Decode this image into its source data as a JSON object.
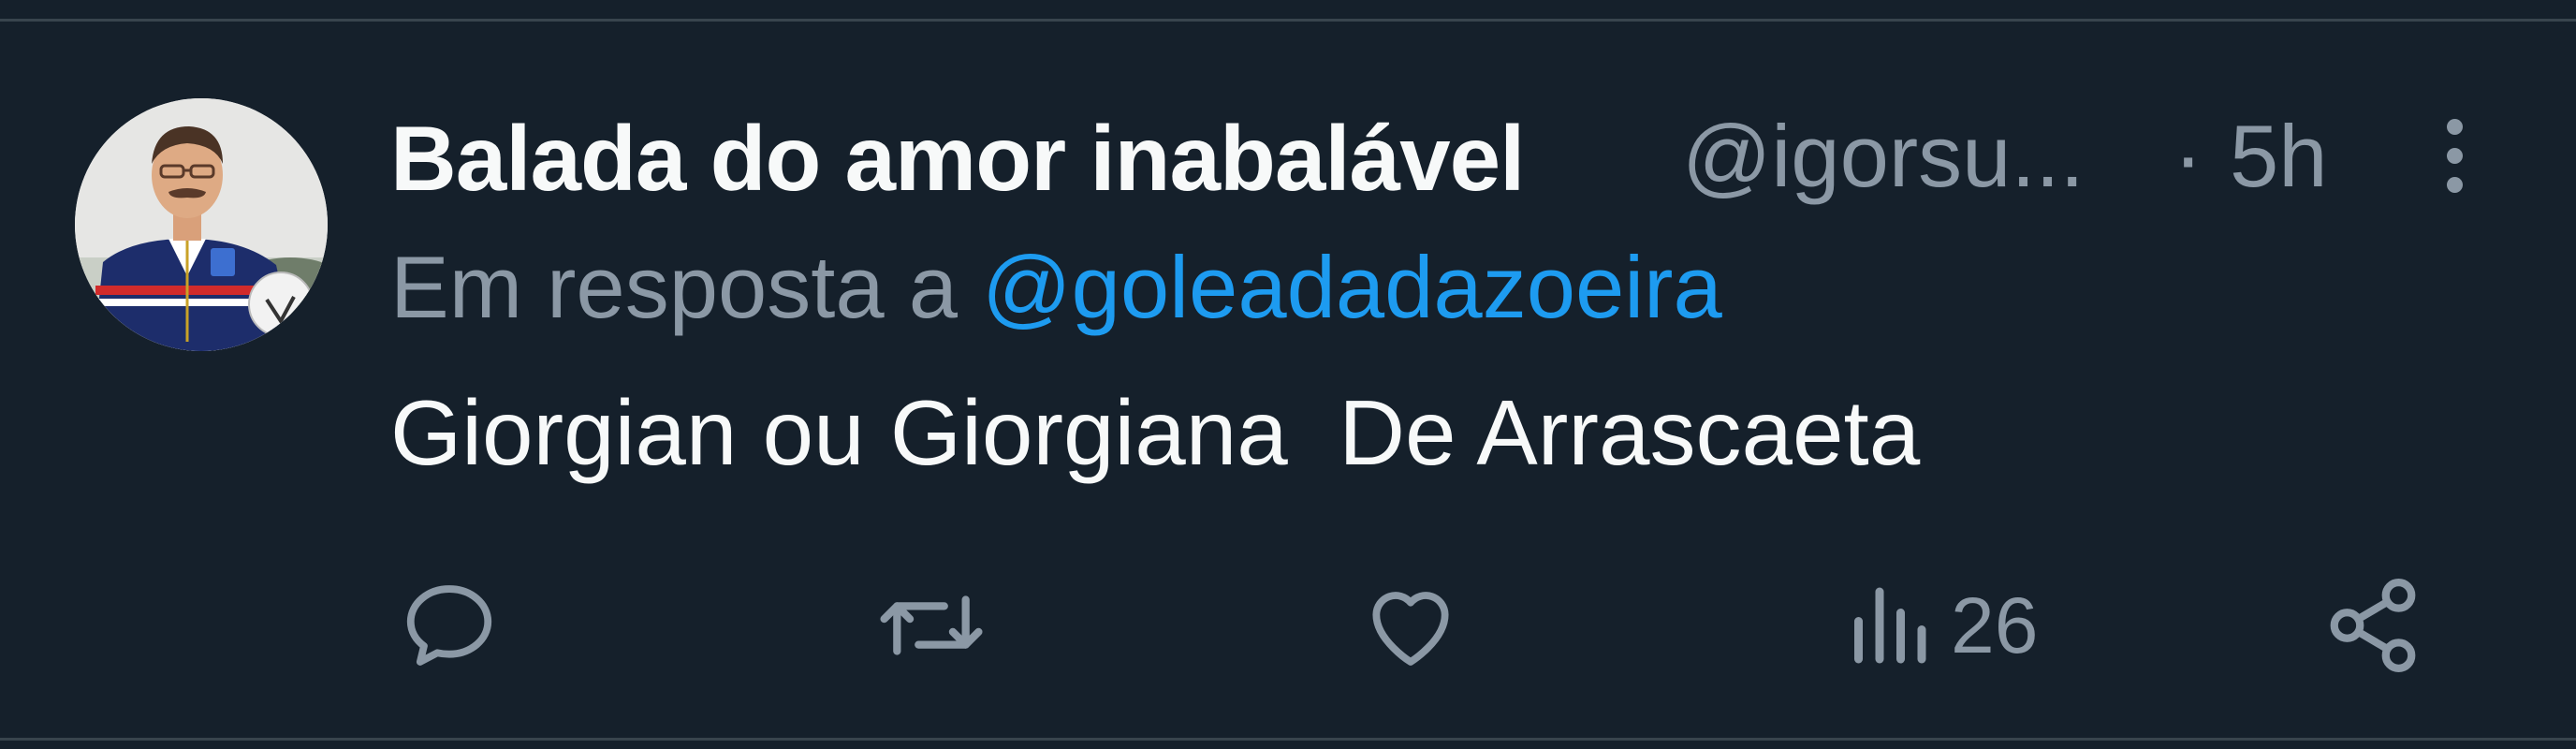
{
  "tweet": {
    "display_name": "Balada do amor inabalável",
    "handle": "@igorsu...",
    "separator": "·",
    "time": "5h",
    "reply_prefix": "Em resposta a ",
    "reply_mention": "@goleadadazoeira",
    "text": "Giorgian ou Giorgiana  De Arrascaeta",
    "views_count": "26"
  },
  "icons": {
    "reply": "reply-icon",
    "retweet": "retweet-icon",
    "like": "heart-icon",
    "views": "views-icon",
    "share": "share-icon",
    "more": "more-options-icon"
  },
  "colors": {
    "background": "#15202b",
    "primary_text": "#f7f9f9",
    "secondary_text": "#8b98a5",
    "accent": "#1d9bf0",
    "divider": "#38444d"
  }
}
